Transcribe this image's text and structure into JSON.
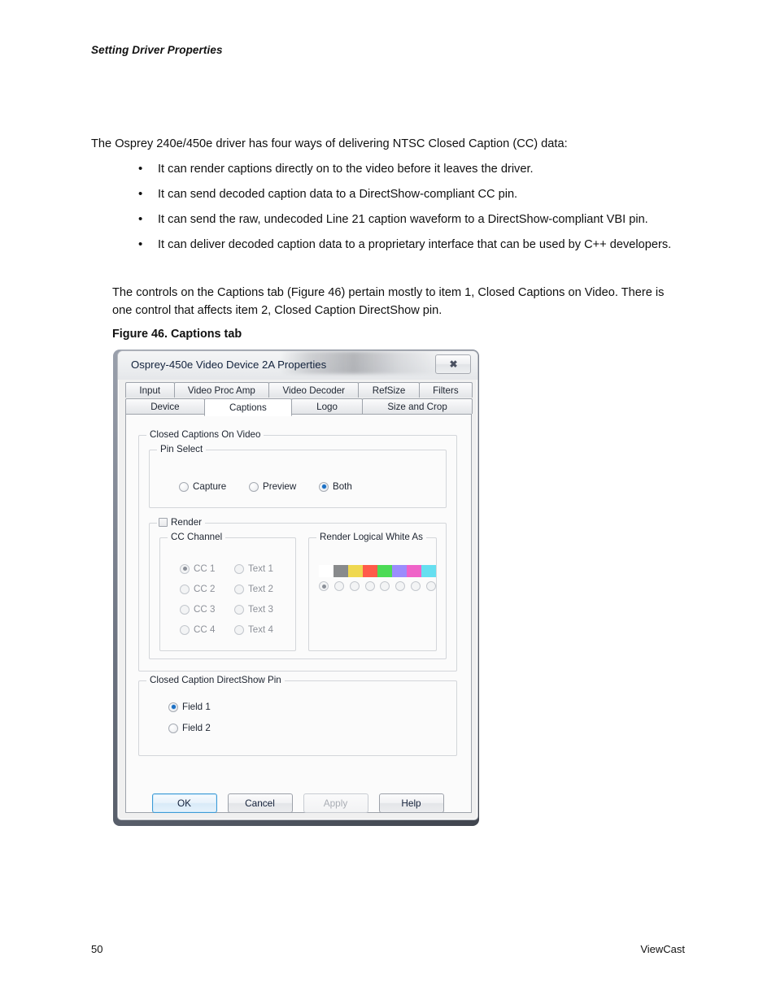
{
  "page": {
    "running_header": "Setting Driver Properties",
    "page_number": "50",
    "brand": "ViewCast"
  },
  "content": {
    "intro": "The Osprey 240e/450e driver has four ways of delivering NTSC Closed Caption (CC) data:",
    "bullets": [
      "It can render captions directly on to the video before it leaves the driver.",
      "It can send decoded caption data to a DirectShow-compliant CC pin.",
      "It can send the raw, undecoded Line 21 caption waveform to a DirectShow-compliant VBI pin.",
      "It can deliver decoded caption data to a proprietary interface that can be used by C++ developers."
    ],
    "bullet_marker": "•",
    "closing": "The controls on the Captions tab (Figure 46) pertain mostly to item 1, Closed Captions on Video. There is one control that affects item 2, Closed Caption DirectShow pin.",
    "figure_caption": "Figure 46. Captions tab"
  },
  "dialog": {
    "title": "Osprey-450e Video Device 2A Properties",
    "close_glyph": "✖",
    "tabs_row1": [
      {
        "label": "Input",
        "active": false
      },
      {
        "label": "Video Proc Amp",
        "active": false
      },
      {
        "label": "Video Decoder",
        "active": false
      },
      {
        "label": "RefSize",
        "active": false
      },
      {
        "label": "Filters",
        "active": false
      }
    ],
    "tabs_row2": [
      {
        "label": "Device",
        "active": false
      },
      {
        "label": "Captions",
        "active": true
      },
      {
        "label": "Logo",
        "active": false
      },
      {
        "label": "Size and Crop",
        "active": false
      }
    ],
    "groups": {
      "cc_on_video": "Closed Captions On Video",
      "pin_select": "Pin Select",
      "render": "Render",
      "cc_channel": "CC Channel",
      "white_as": "Render Logical White As",
      "ds_pin": "Closed Caption DirectShow Pin"
    },
    "pin_select": {
      "options": [
        {
          "label": "Capture",
          "checked": false
        },
        {
          "label": "Preview",
          "checked": false
        },
        {
          "label": "Both",
          "checked": true
        }
      ]
    },
    "render": {
      "checked": false,
      "enabled": false
    },
    "cc_channel": {
      "enabled": false,
      "left_column": [
        {
          "label": "CC 1",
          "checked": true
        },
        {
          "label": "CC 2",
          "checked": false
        },
        {
          "label": "CC 3",
          "checked": false
        },
        {
          "label": "CC 4",
          "checked": false
        }
      ],
      "right_column": [
        {
          "label": "Text 1",
          "checked": false
        },
        {
          "label": "Text 2",
          "checked": false
        },
        {
          "label": "Text 3",
          "checked": false
        },
        {
          "label": "Text 4",
          "checked": false
        }
      ]
    },
    "white_as": {
      "enabled": false,
      "selected_index": 0,
      "swatches": [
        {
          "name": "white",
          "color": "#ffffff"
        },
        {
          "name": "gray",
          "color": "#888a8c"
        },
        {
          "name": "yellow",
          "color": "#efd850"
        },
        {
          "name": "red",
          "color": "#ff5b4a"
        },
        {
          "name": "green",
          "color": "#4cdb56"
        },
        {
          "name": "blue",
          "color": "#9b8cfc"
        },
        {
          "name": "magenta",
          "color": "#ef63c8"
        },
        {
          "name": "cyan",
          "color": "#66dff0"
        }
      ]
    },
    "ds_pin": {
      "options": [
        {
          "label": "Field 1",
          "checked": true
        },
        {
          "label": "Field 2",
          "checked": false
        }
      ]
    },
    "buttons": [
      {
        "label": "OK",
        "state": "default"
      },
      {
        "label": "Cancel",
        "state": "normal"
      },
      {
        "label": "Apply",
        "state": "disabled"
      },
      {
        "label": "Help",
        "state": "normal"
      }
    ]
  }
}
